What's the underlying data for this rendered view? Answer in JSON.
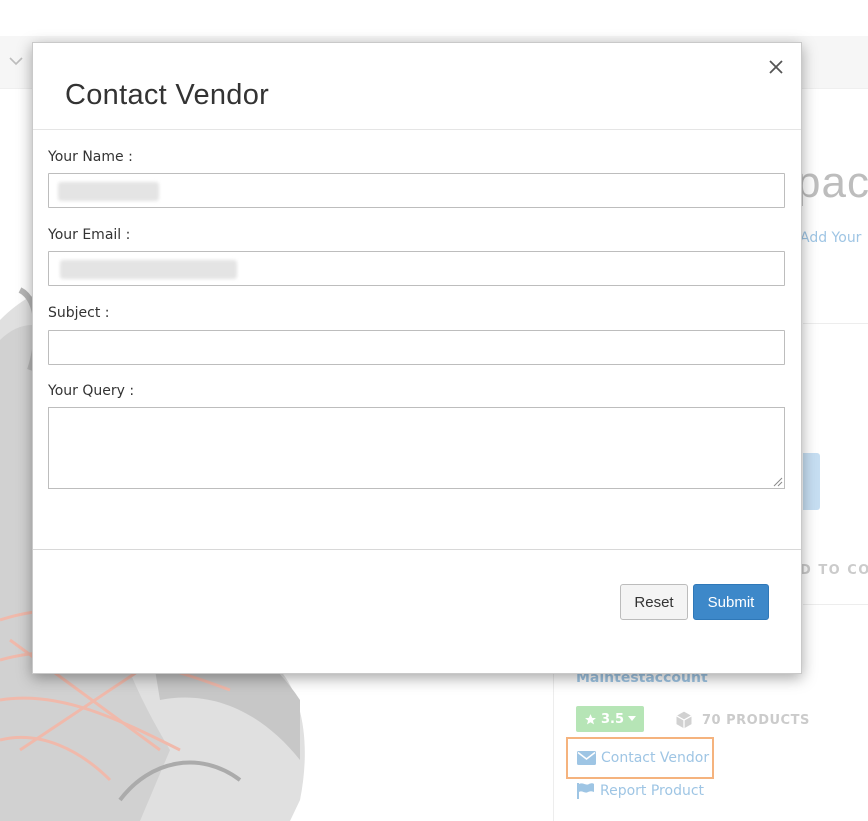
{
  "background": {
    "product_title_fragment": "pack",
    "add_review_fragment": "Add Your",
    "add_to_compare_fragment": "D TO CO",
    "vendor": {
      "name": "Maintestaccount",
      "rating": "3.5",
      "products_count": "70 PRODUCTS",
      "contact_vendor_label": "Contact Vendor",
      "report_product_label": "Report Product"
    }
  },
  "modal": {
    "title": "Contact Vendor",
    "fields": {
      "name": {
        "label": "Your Name :",
        "value": "",
        "obscured": true
      },
      "email": {
        "label": "Your Email :",
        "value": "",
        "obscured": true
      },
      "subject": {
        "label": "Subject :",
        "value": ""
      },
      "query": {
        "label": "Your Query :",
        "value": ""
      }
    },
    "buttons": {
      "reset": "Reset",
      "submit": "Submit"
    }
  },
  "colors": {
    "submit": "#3d88c9",
    "link": "#6ba6d6",
    "highlight_outline": "#f08a3a",
    "rating_badge": "#8fd88f"
  },
  "icons": [
    "chevron-down-icon",
    "close-icon",
    "star-icon",
    "caret-down-icon",
    "cube-icon",
    "envelope-icon",
    "flag-icon",
    "resize-grip-icon"
  ]
}
